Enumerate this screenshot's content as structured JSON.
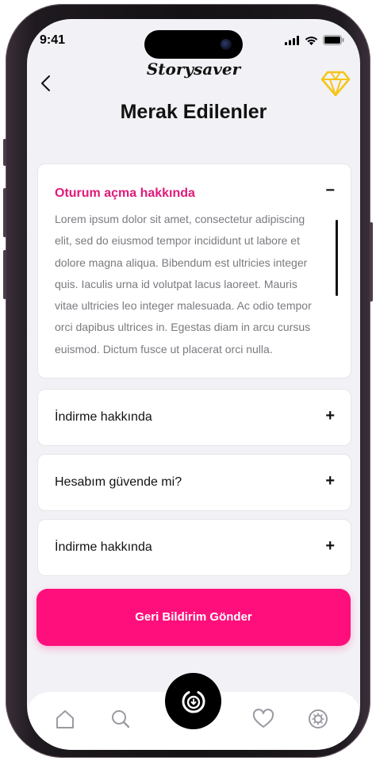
{
  "status": {
    "time": "9:41"
  },
  "brand": "Storysaver",
  "page": {
    "title": "Merak Edilenler"
  },
  "faq": [
    {
      "question": "Oturum açma hakkında",
      "answer": "Lorem ipsum dolor sit amet, consectetur adipiscing elit, sed do eiusmod tempor incididunt ut labore et dolore magna aliqua. Bibendum est ultricies integer quis. Iaculis urna id volutpat lacus laoreet. Mauris vitae ultricies leo integer malesuada. Ac odio tempor orci dapibus ultrices in. Egestas diam in arcu cursus euismod. Dictum fusce ut placerat orci nulla.",
      "expanded": true,
      "toggle": "−"
    },
    {
      "question": "İndirme hakkında",
      "expanded": false,
      "toggle": "+"
    },
    {
      "question": "Hesabım güvende mi?",
      "expanded": false,
      "toggle": "+"
    },
    {
      "question": "İndirme hakkında",
      "expanded": false,
      "toggle": "+"
    }
  ],
  "cta": {
    "label": "Geri Bildirim Gönder"
  },
  "colors": {
    "accent": "#ff0f7b",
    "accent_text": "#e01a7a",
    "premium": "#f5c518"
  },
  "icons": {
    "back": "chevron-left-icon",
    "premium": "diamond-icon",
    "tabs": [
      "home-icon",
      "search-icon",
      "download-icon",
      "heart-icon",
      "settings-icon"
    ]
  }
}
